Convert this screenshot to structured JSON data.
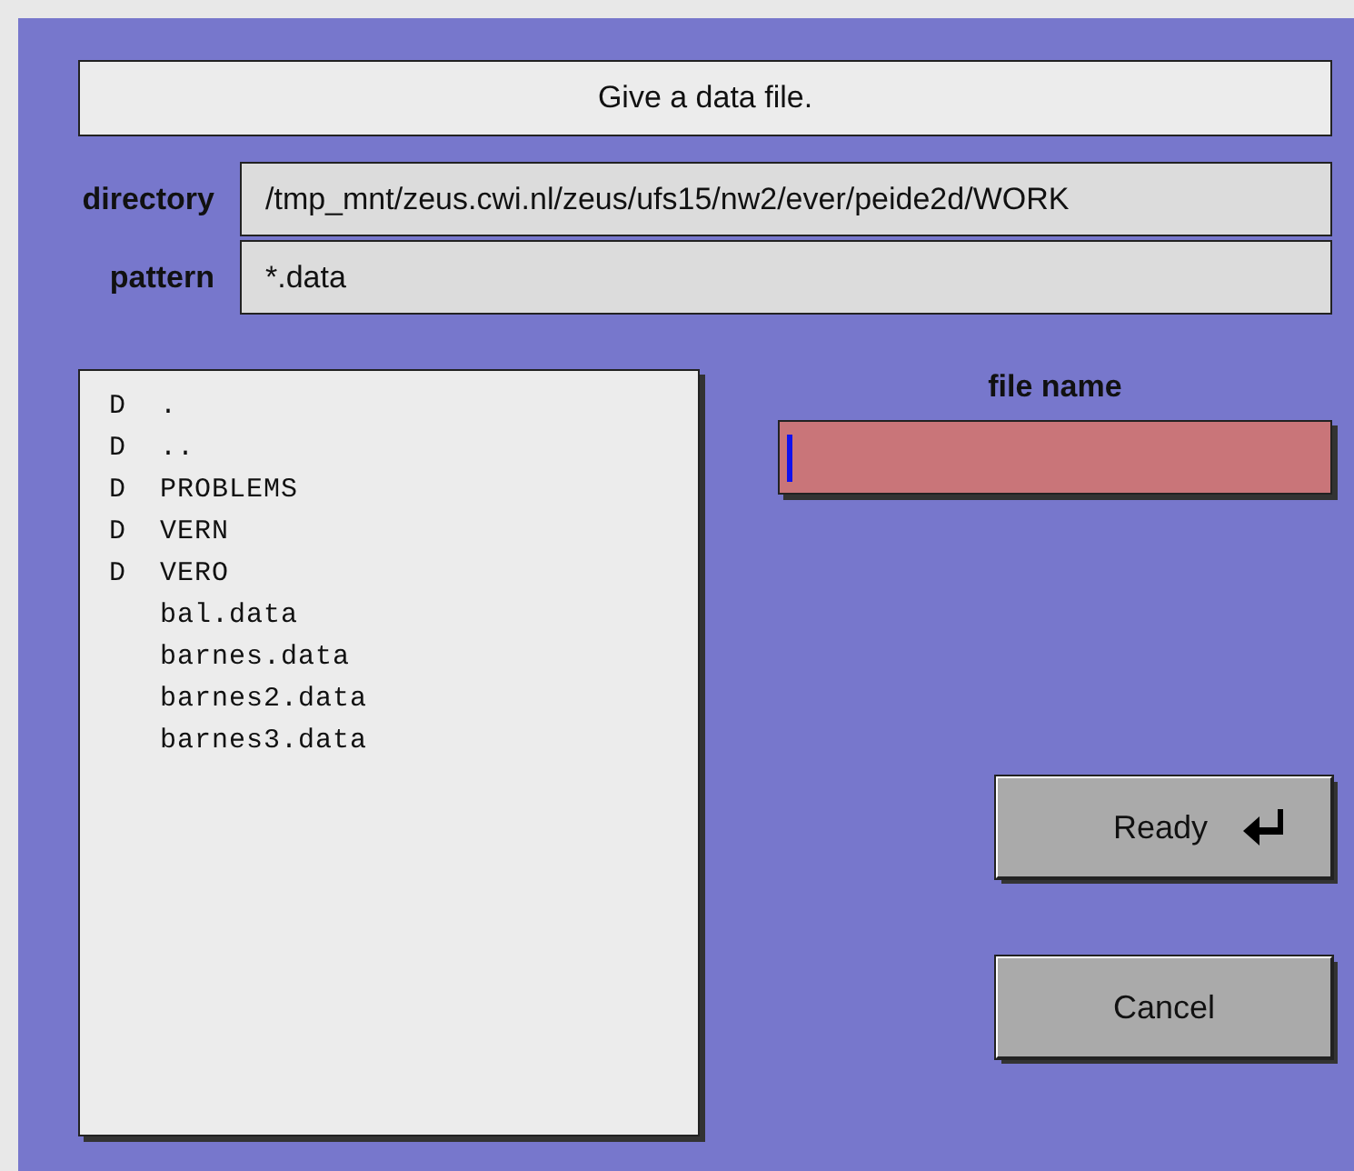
{
  "prompt": "Give a data file.",
  "directory": {
    "label": "directory",
    "value": "/tmp_mnt/zeus.cwi.nl/zeus/ufs15/nw2/ever/peide2d/WORK"
  },
  "pattern": {
    "label": "pattern",
    "value": "*.data"
  },
  "files": [
    {
      "flag": "D",
      "name": "."
    },
    {
      "flag": "D",
      "name": ".."
    },
    {
      "flag": "D",
      "name": "PROBLEMS"
    },
    {
      "flag": "D",
      "name": "VERN"
    },
    {
      "flag": "D",
      "name": "VERO"
    },
    {
      "name": "bal.data"
    },
    {
      "name": "barnes.data"
    },
    {
      "name": "barnes2.data"
    },
    {
      "name": "barnes3.data"
    }
  ],
  "file_name": {
    "label": "file name",
    "focused": true
  },
  "buttons": [
    {
      "label": "Ready",
      "kind": "default"
    },
    {
      "label": "Cancel",
      "kind": "plain"
    }
  ]
}
